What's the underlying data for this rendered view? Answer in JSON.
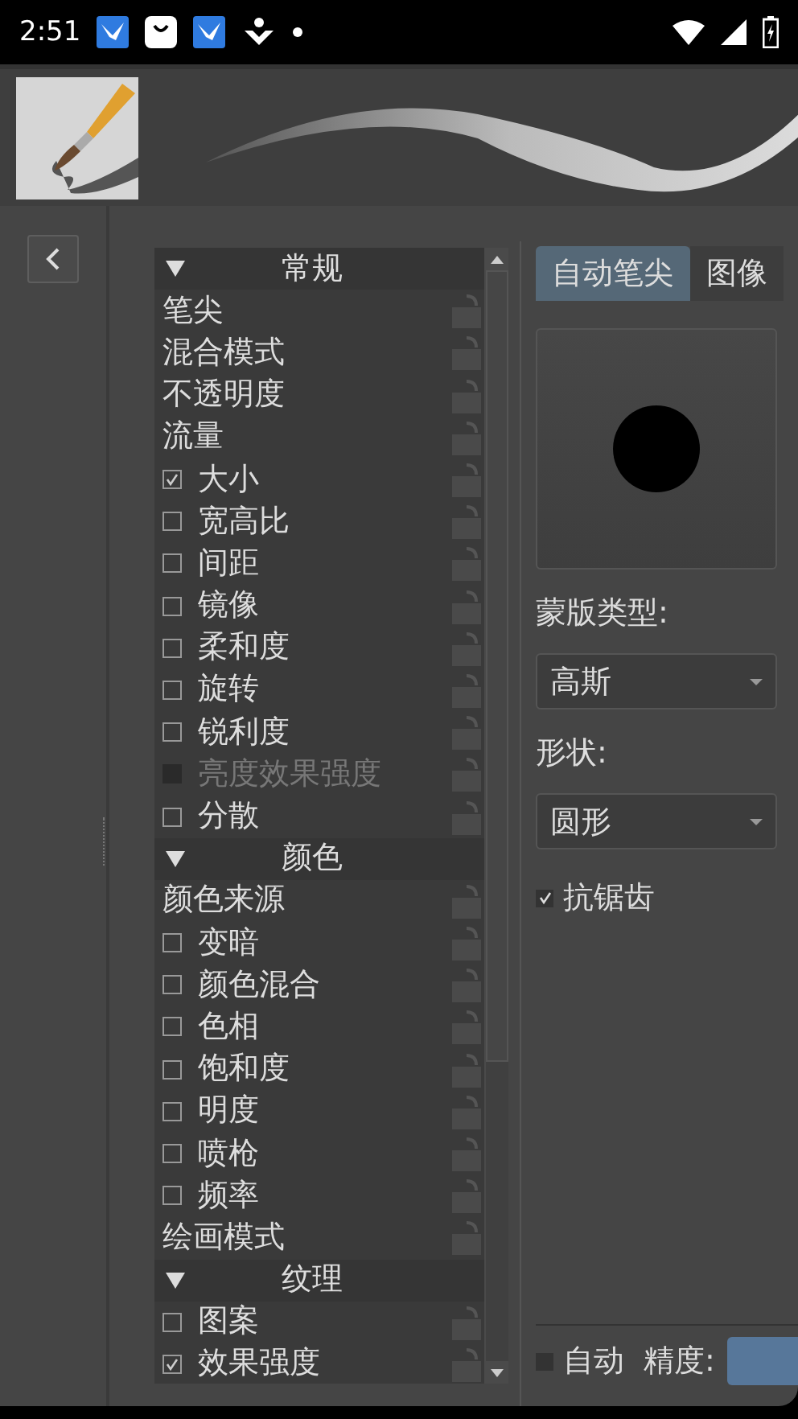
{
  "status_bar": {
    "time": "2:51"
  },
  "sections": [
    {
      "kind": "header",
      "label": "常规",
      "expanded": true
    },
    {
      "kind": "plain",
      "label": "笔尖"
    },
    {
      "kind": "plain",
      "label": "混合模式"
    },
    {
      "kind": "plain",
      "label": "不透明度"
    },
    {
      "kind": "plain",
      "label": "流量"
    },
    {
      "kind": "check",
      "label": "大小",
      "checked": true,
      "disabled": false
    },
    {
      "kind": "check",
      "label": "宽高比",
      "checked": false,
      "disabled": false
    },
    {
      "kind": "check",
      "label": "间距",
      "checked": false,
      "disabled": false
    },
    {
      "kind": "check",
      "label": "镜像",
      "checked": false,
      "disabled": false
    },
    {
      "kind": "check",
      "label": "柔和度",
      "checked": false,
      "disabled": false
    },
    {
      "kind": "check",
      "label": "旋转",
      "checked": false,
      "disabled": false
    },
    {
      "kind": "check",
      "label": "锐利度",
      "checked": false,
      "disabled": false
    },
    {
      "kind": "check",
      "label": "亮度效果强度",
      "checked": false,
      "disabled": true
    },
    {
      "kind": "check",
      "label": "分散",
      "checked": false,
      "disabled": false
    },
    {
      "kind": "header",
      "label": "颜色",
      "expanded": true
    },
    {
      "kind": "plain",
      "label": "颜色来源"
    },
    {
      "kind": "check",
      "label": "变暗",
      "checked": false,
      "disabled": false
    },
    {
      "kind": "check",
      "label": "颜色混合",
      "checked": false,
      "disabled": false
    },
    {
      "kind": "check",
      "label": "色相",
      "checked": false,
      "disabled": false
    },
    {
      "kind": "check",
      "label": "饱和度",
      "checked": false,
      "disabled": false
    },
    {
      "kind": "check",
      "label": "明度",
      "checked": false,
      "disabled": false
    },
    {
      "kind": "check",
      "label": "喷枪",
      "checked": false,
      "disabled": false
    },
    {
      "kind": "check",
      "label": "频率",
      "checked": false,
      "disabled": false
    },
    {
      "kind": "plain",
      "label": "绘画模式"
    },
    {
      "kind": "header",
      "label": "纹理",
      "expanded": true
    },
    {
      "kind": "check",
      "label": "图案",
      "checked": false,
      "disabled": false
    },
    {
      "kind": "check",
      "label": "效果强度",
      "checked": true,
      "disabled": false
    }
  ],
  "tabs": [
    {
      "label": "自动笔尖",
      "selected": true
    },
    {
      "label": "图像",
      "selected": false
    }
  ],
  "mask_type": {
    "label": "蒙版类型:",
    "value": "高斯"
  },
  "shape": {
    "label": "形状:",
    "value": "圆形"
  },
  "antialias": {
    "label": "抗锯齿",
    "checked": true
  },
  "auto": {
    "label": "自动",
    "checked": false
  },
  "precision": {
    "label": "精度:"
  }
}
